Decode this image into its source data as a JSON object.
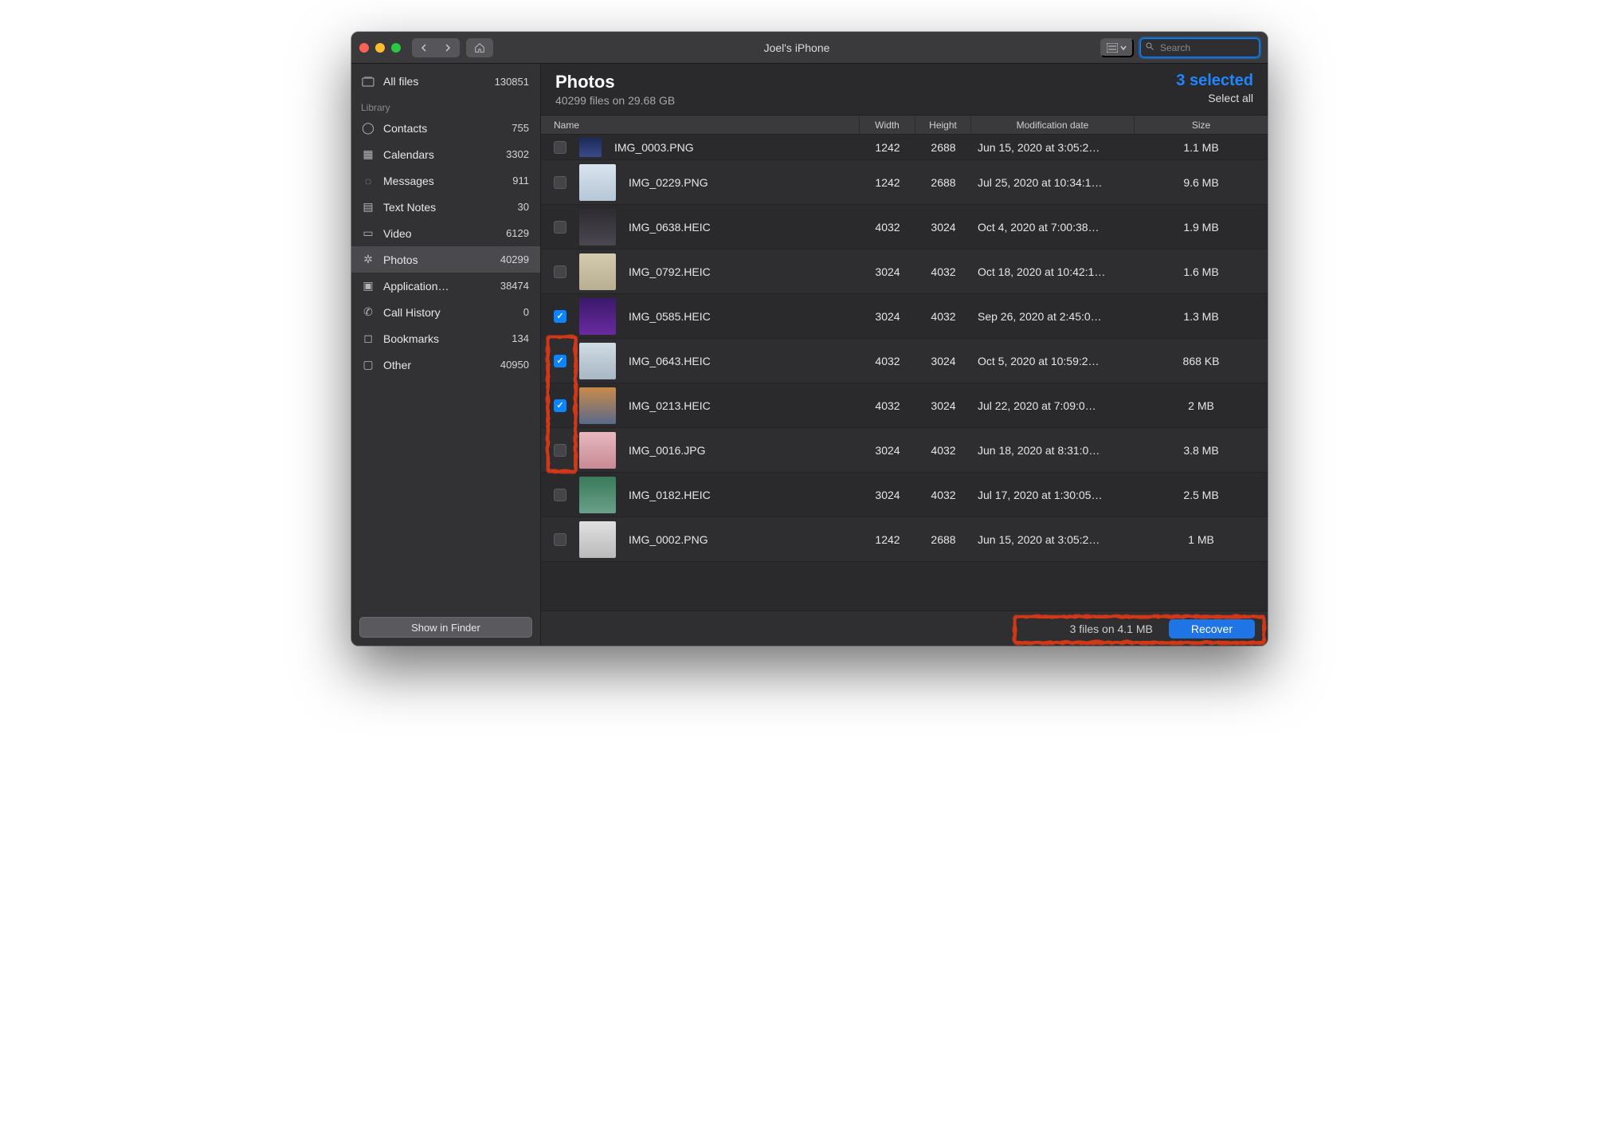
{
  "window": {
    "title": "Joel's iPhone",
    "search_placeholder": "Search"
  },
  "sidebar": {
    "all_label": "All files",
    "all_count": "130851",
    "group_label": "Library",
    "items": [
      {
        "label": "Contacts",
        "count": "755"
      },
      {
        "label": "Calendars",
        "count": "3302"
      },
      {
        "label": "Messages",
        "count": "911"
      },
      {
        "label": "Text Notes",
        "count": "30"
      },
      {
        "label": "Video",
        "count": "6129"
      },
      {
        "label": "Photos",
        "count": "40299"
      },
      {
        "label": "Application…",
        "count": "38474"
      },
      {
        "label": "Call History",
        "count": "0"
      },
      {
        "label": "Bookmarks",
        "count": "134"
      },
      {
        "label": "Other",
        "count": "40950"
      }
    ],
    "finder_label": "Show in Finder"
  },
  "header": {
    "title": "Photos",
    "subtitle": "40299 files on 29.68 GB",
    "selected_text": "3 selected",
    "select_all_label": "Select all"
  },
  "columns": {
    "name": "Name",
    "width": "Width",
    "height": "Height",
    "date": "Modification date",
    "size": "Size"
  },
  "rows": [
    {
      "checked": false,
      "name": "IMG_0003.PNG",
      "w": "1242",
      "h": "2688",
      "date": "Jun 15, 2020 at 3:05:2…",
      "size": "1.1 MB"
    },
    {
      "checked": false,
      "name": "IMG_0229.PNG",
      "w": "1242",
      "h": "2688",
      "date": "Jul 25, 2020 at 10:34:1…",
      "size": "9.6 MB"
    },
    {
      "checked": false,
      "name": "IMG_0638.HEIC",
      "w": "4032",
      "h": "3024",
      "date": "Oct 4, 2020 at 7:00:38…",
      "size": "1.9 MB"
    },
    {
      "checked": false,
      "name": "IMG_0792.HEIC",
      "w": "3024",
      "h": "4032",
      "date": "Oct 18, 2020 at 10:42:1…",
      "size": "1.6 MB"
    },
    {
      "checked": true,
      "name": "IMG_0585.HEIC",
      "w": "3024",
      "h": "4032",
      "date": "Sep 26, 2020 at 2:45:0…",
      "size": "1.3 MB"
    },
    {
      "checked": true,
      "name": "IMG_0643.HEIC",
      "w": "4032",
      "h": "3024",
      "date": "Oct 5, 2020 at 10:59:2…",
      "size": "868 KB"
    },
    {
      "checked": true,
      "name": "IMG_0213.HEIC",
      "w": "4032",
      "h": "3024",
      "date": "Jul 22, 2020 at 7:09:0…",
      "size": "2 MB"
    },
    {
      "checked": false,
      "name": "IMG_0016.JPG",
      "w": "3024",
      "h": "4032",
      "date": "Jun 18, 2020 at 8:31:0…",
      "size": "3.8 MB"
    },
    {
      "checked": false,
      "name": "IMG_0182.HEIC",
      "w": "3024",
      "h": "4032",
      "date": "Jul 17, 2020 at 1:30:05…",
      "size": "2.5 MB"
    },
    {
      "checked": false,
      "name": "IMG_0002.PNG",
      "w": "1242",
      "h": "2688",
      "date": "Jun 15, 2020 at 3:05:2…",
      "size": "1 MB"
    }
  ],
  "footer": {
    "status": "3 files on 4.1 MB",
    "recover_label": "Recover"
  }
}
